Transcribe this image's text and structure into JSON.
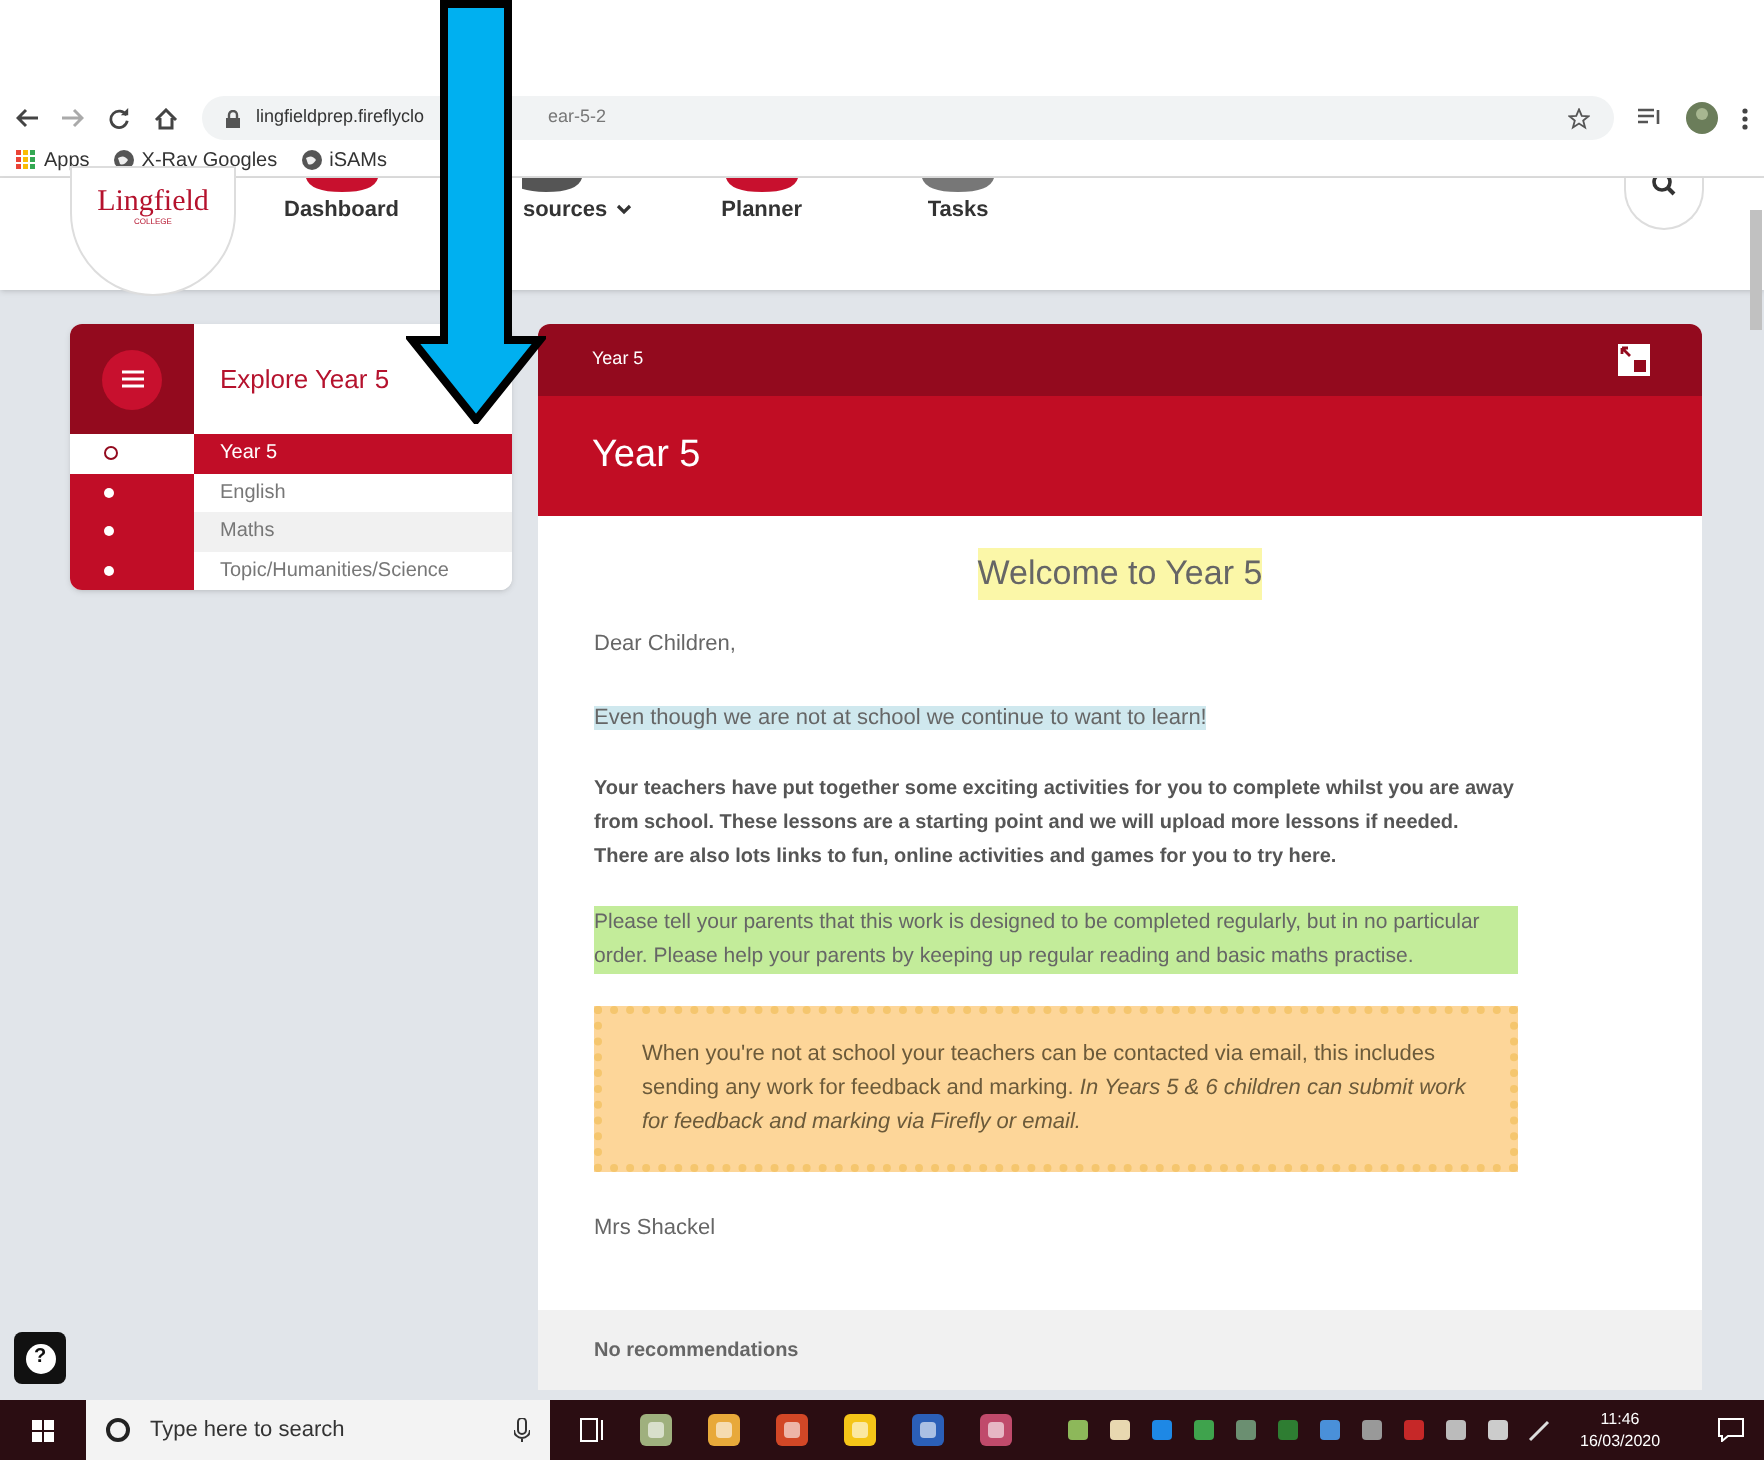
{
  "browser": {
    "url_start": "lingfieldprep.fireflyclo",
    "url_end": "ear-5-2",
    "bookmarks": [
      {
        "label": "Apps",
        "kind": "apps"
      },
      {
        "label": "X-Ray Googles",
        "kind": "globe"
      },
      {
        "label": "iSAMs",
        "kind": "globe"
      }
    ]
  },
  "site_header": {
    "logo": "Lingfield",
    "logo_sub": "COLLEGE",
    "nav": [
      {
        "label": "Dashboard",
        "color": "#c8102e",
        "dropdown": false
      },
      {
        "label": "sources",
        "color": "#555555",
        "dropdown": true
      },
      {
        "label": "Planner",
        "color": "#c8102e",
        "dropdown": false
      },
      {
        "label": "Tasks",
        "color": "#777777",
        "dropdown": false
      }
    ]
  },
  "sidebar": {
    "title": "Explore Year 5",
    "items": [
      {
        "label": "Year 5",
        "selected": true
      },
      {
        "label": "English",
        "selected": false
      },
      {
        "label": "Maths",
        "selected": false
      },
      {
        "label": "Topic/Humanities/Science",
        "selected": false
      }
    ]
  },
  "page": {
    "breadcrumb": "Year 5",
    "title": "Year 5",
    "heading": "Welcome to Year 5",
    "paragraphs": [
      {
        "kind": "plain",
        "text": "Dear Children,"
      },
      {
        "kind": "blue",
        "text": "Even though we are not at school we continue to want to learn!"
      },
      {
        "kind": "bold",
        "text": "Your teachers have put together some exciting activities for you to complete whilst you are away from school. These lessons are a starting point and we will upload more lessons if needed. There are also lots links to fun, online activities and games for you to try here."
      },
      {
        "kind": "green",
        "text": "Please tell your parents that this work is designed to be completed regularly, but in no particular order. Please help your parents by keeping up regular reading and basic maths practise."
      },
      {
        "kind": "callout",
        "text": "When you're not at school your teachers can be contacted via email, this includes sending any work for feedback and marking. *In Years 5 & 6 children can submit work for feedback and marking via Firefly or email.*"
      },
      {
        "kind": "plain",
        "text": "Mrs Shackel"
      }
    ],
    "footer": "No recommendations"
  },
  "help": "?",
  "taskbar": {
    "search_placeholder": "Type here to search",
    "time": "11:46",
    "date": "16/03/2020"
  }
}
